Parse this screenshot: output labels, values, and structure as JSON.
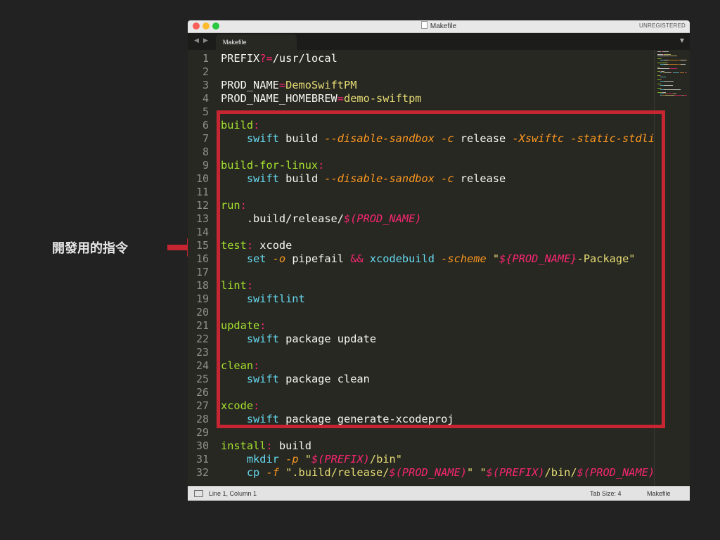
{
  "annotation": {
    "label": "開發用的指令"
  },
  "window": {
    "title": "Makefile",
    "unregistered": "UNREGISTERED",
    "tab": "Makefile"
  },
  "editor": {
    "lines": [
      {
        "n": "1",
        "tokens": [
          [
            "t",
            "PREFIX"
          ],
          [
            "op",
            "?="
          ],
          [
            "t",
            "/usr/local"
          ]
        ]
      },
      {
        "n": "2",
        "tokens": []
      },
      {
        "n": "3",
        "tokens": [
          [
            "t",
            "PROD_NAME"
          ],
          [
            "op",
            "="
          ],
          [
            "str",
            "DemoSwiftPM"
          ]
        ]
      },
      {
        "n": "4",
        "tokens": [
          [
            "t",
            "PROD_NAME_HOMEBREW"
          ],
          [
            "op",
            "="
          ],
          [
            "str",
            "demo-swiftpm"
          ]
        ]
      },
      {
        "n": "5",
        "tokens": []
      },
      {
        "n": "6",
        "tokens": [
          [
            "kw",
            "build"
          ],
          [
            "op",
            ":"
          ]
        ]
      },
      {
        "n": "7",
        "tokens": [
          [
            "t",
            "    "
          ],
          [
            "fn",
            "swift"
          ],
          [
            "t",
            " build "
          ],
          [
            "arg",
            "--disable-sandbox"
          ],
          [
            "t",
            " "
          ],
          [
            "arg",
            "-c"
          ],
          [
            "t",
            " release "
          ],
          [
            "arg",
            "-Xswiftc"
          ],
          [
            "t",
            " "
          ],
          [
            "arg",
            "-static-stdlib"
          ]
        ]
      },
      {
        "n": "8",
        "tokens": []
      },
      {
        "n": "9",
        "tokens": [
          [
            "kw",
            "build-for-linux"
          ],
          [
            "op",
            ":"
          ]
        ]
      },
      {
        "n": "10",
        "tokens": [
          [
            "t",
            "    "
          ],
          [
            "fn",
            "swift"
          ],
          [
            "t",
            " build "
          ],
          [
            "arg",
            "--disable-sandbox"
          ],
          [
            "t",
            " "
          ],
          [
            "arg",
            "-c"
          ],
          [
            "t",
            " release"
          ]
        ]
      },
      {
        "n": "11",
        "tokens": []
      },
      {
        "n": "12",
        "tokens": [
          [
            "kw",
            "run"
          ],
          [
            "op",
            ":"
          ]
        ]
      },
      {
        "n": "13",
        "tokens": [
          [
            "t",
            "    .build/release/"
          ],
          [
            "var",
            "$(PROD_NAME)"
          ]
        ]
      },
      {
        "n": "14",
        "tokens": []
      },
      {
        "n": "15",
        "tokens": [
          [
            "kw",
            "test"
          ],
          [
            "op",
            ":"
          ],
          [
            "t",
            " xcode"
          ]
        ]
      },
      {
        "n": "16",
        "tokens": [
          [
            "t",
            "    "
          ],
          [
            "fn",
            "set"
          ],
          [
            "t",
            " "
          ],
          [
            "arg",
            "-o"
          ],
          [
            "t",
            " pipefail "
          ],
          [
            "op",
            "&&"
          ],
          [
            "t",
            " "
          ],
          [
            "fn",
            "xcodebuild"
          ],
          [
            "t",
            " "
          ],
          [
            "arg",
            "-scheme"
          ],
          [
            "t",
            " "
          ],
          [
            "str",
            "\""
          ],
          [
            "var",
            "${PROD_NAME}"
          ],
          [
            "str",
            "-Package\""
          ]
        ]
      },
      {
        "n": "17",
        "tokens": []
      },
      {
        "n": "18",
        "tokens": [
          [
            "kw",
            "lint"
          ],
          [
            "op",
            ":"
          ]
        ]
      },
      {
        "n": "19",
        "tokens": [
          [
            "t",
            "    "
          ],
          [
            "fn",
            "swiftlint"
          ]
        ]
      },
      {
        "n": "20",
        "tokens": []
      },
      {
        "n": "21",
        "tokens": [
          [
            "kw",
            "update"
          ],
          [
            "op",
            ":"
          ]
        ]
      },
      {
        "n": "22",
        "tokens": [
          [
            "t",
            "    "
          ],
          [
            "fn",
            "swift"
          ],
          [
            "t",
            " package update"
          ]
        ]
      },
      {
        "n": "23",
        "tokens": []
      },
      {
        "n": "24",
        "tokens": [
          [
            "kw",
            "clean"
          ],
          [
            "op",
            ":"
          ]
        ]
      },
      {
        "n": "25",
        "tokens": [
          [
            "t",
            "    "
          ],
          [
            "fn",
            "swift"
          ],
          [
            "t",
            " package clean"
          ]
        ]
      },
      {
        "n": "26",
        "tokens": []
      },
      {
        "n": "27",
        "tokens": [
          [
            "kw",
            "xcode"
          ],
          [
            "op",
            ":"
          ]
        ]
      },
      {
        "n": "28",
        "tokens": [
          [
            "t",
            "    "
          ],
          [
            "fn",
            "swift"
          ],
          [
            "t",
            " package generate-xcodeproj"
          ]
        ]
      },
      {
        "n": "29",
        "tokens": []
      },
      {
        "n": "30",
        "tokens": [
          [
            "kw",
            "install"
          ],
          [
            "op",
            ":"
          ],
          [
            "t",
            " build"
          ]
        ]
      },
      {
        "n": "31",
        "tokens": [
          [
            "t",
            "    "
          ],
          [
            "fn",
            "mkdir"
          ],
          [
            "t",
            " "
          ],
          [
            "arg",
            "-p"
          ],
          [
            "t",
            " "
          ],
          [
            "str",
            "\""
          ],
          [
            "var",
            "$(PREFIX)"
          ],
          [
            "str",
            "/bin\""
          ]
        ]
      },
      {
        "n": "32",
        "tokens": [
          [
            "t",
            "    "
          ],
          [
            "fn",
            "cp"
          ],
          [
            "t",
            " "
          ],
          [
            "arg",
            "-f"
          ],
          [
            "t",
            " "
          ],
          [
            "str",
            "\".build/release/"
          ],
          [
            "var",
            "$(PROD_NAME)"
          ],
          [
            "str",
            "\""
          ],
          [
            "t",
            " "
          ],
          [
            "str",
            "\""
          ],
          [
            "var",
            "$(PREFIX)"
          ],
          [
            "str",
            "/bin/"
          ],
          [
            "var",
            "$(PROD_NAME)"
          ],
          [
            "str",
            "\""
          ]
        ]
      }
    ]
  },
  "status": {
    "position": "Line 1, Column 1",
    "tab_size": "Tab Size: 4",
    "syntax": "Makefile"
  },
  "colors": {
    "highlight_box": "#c62532",
    "arrow": "#c62532",
    "editor_bg": "#272822"
  }
}
